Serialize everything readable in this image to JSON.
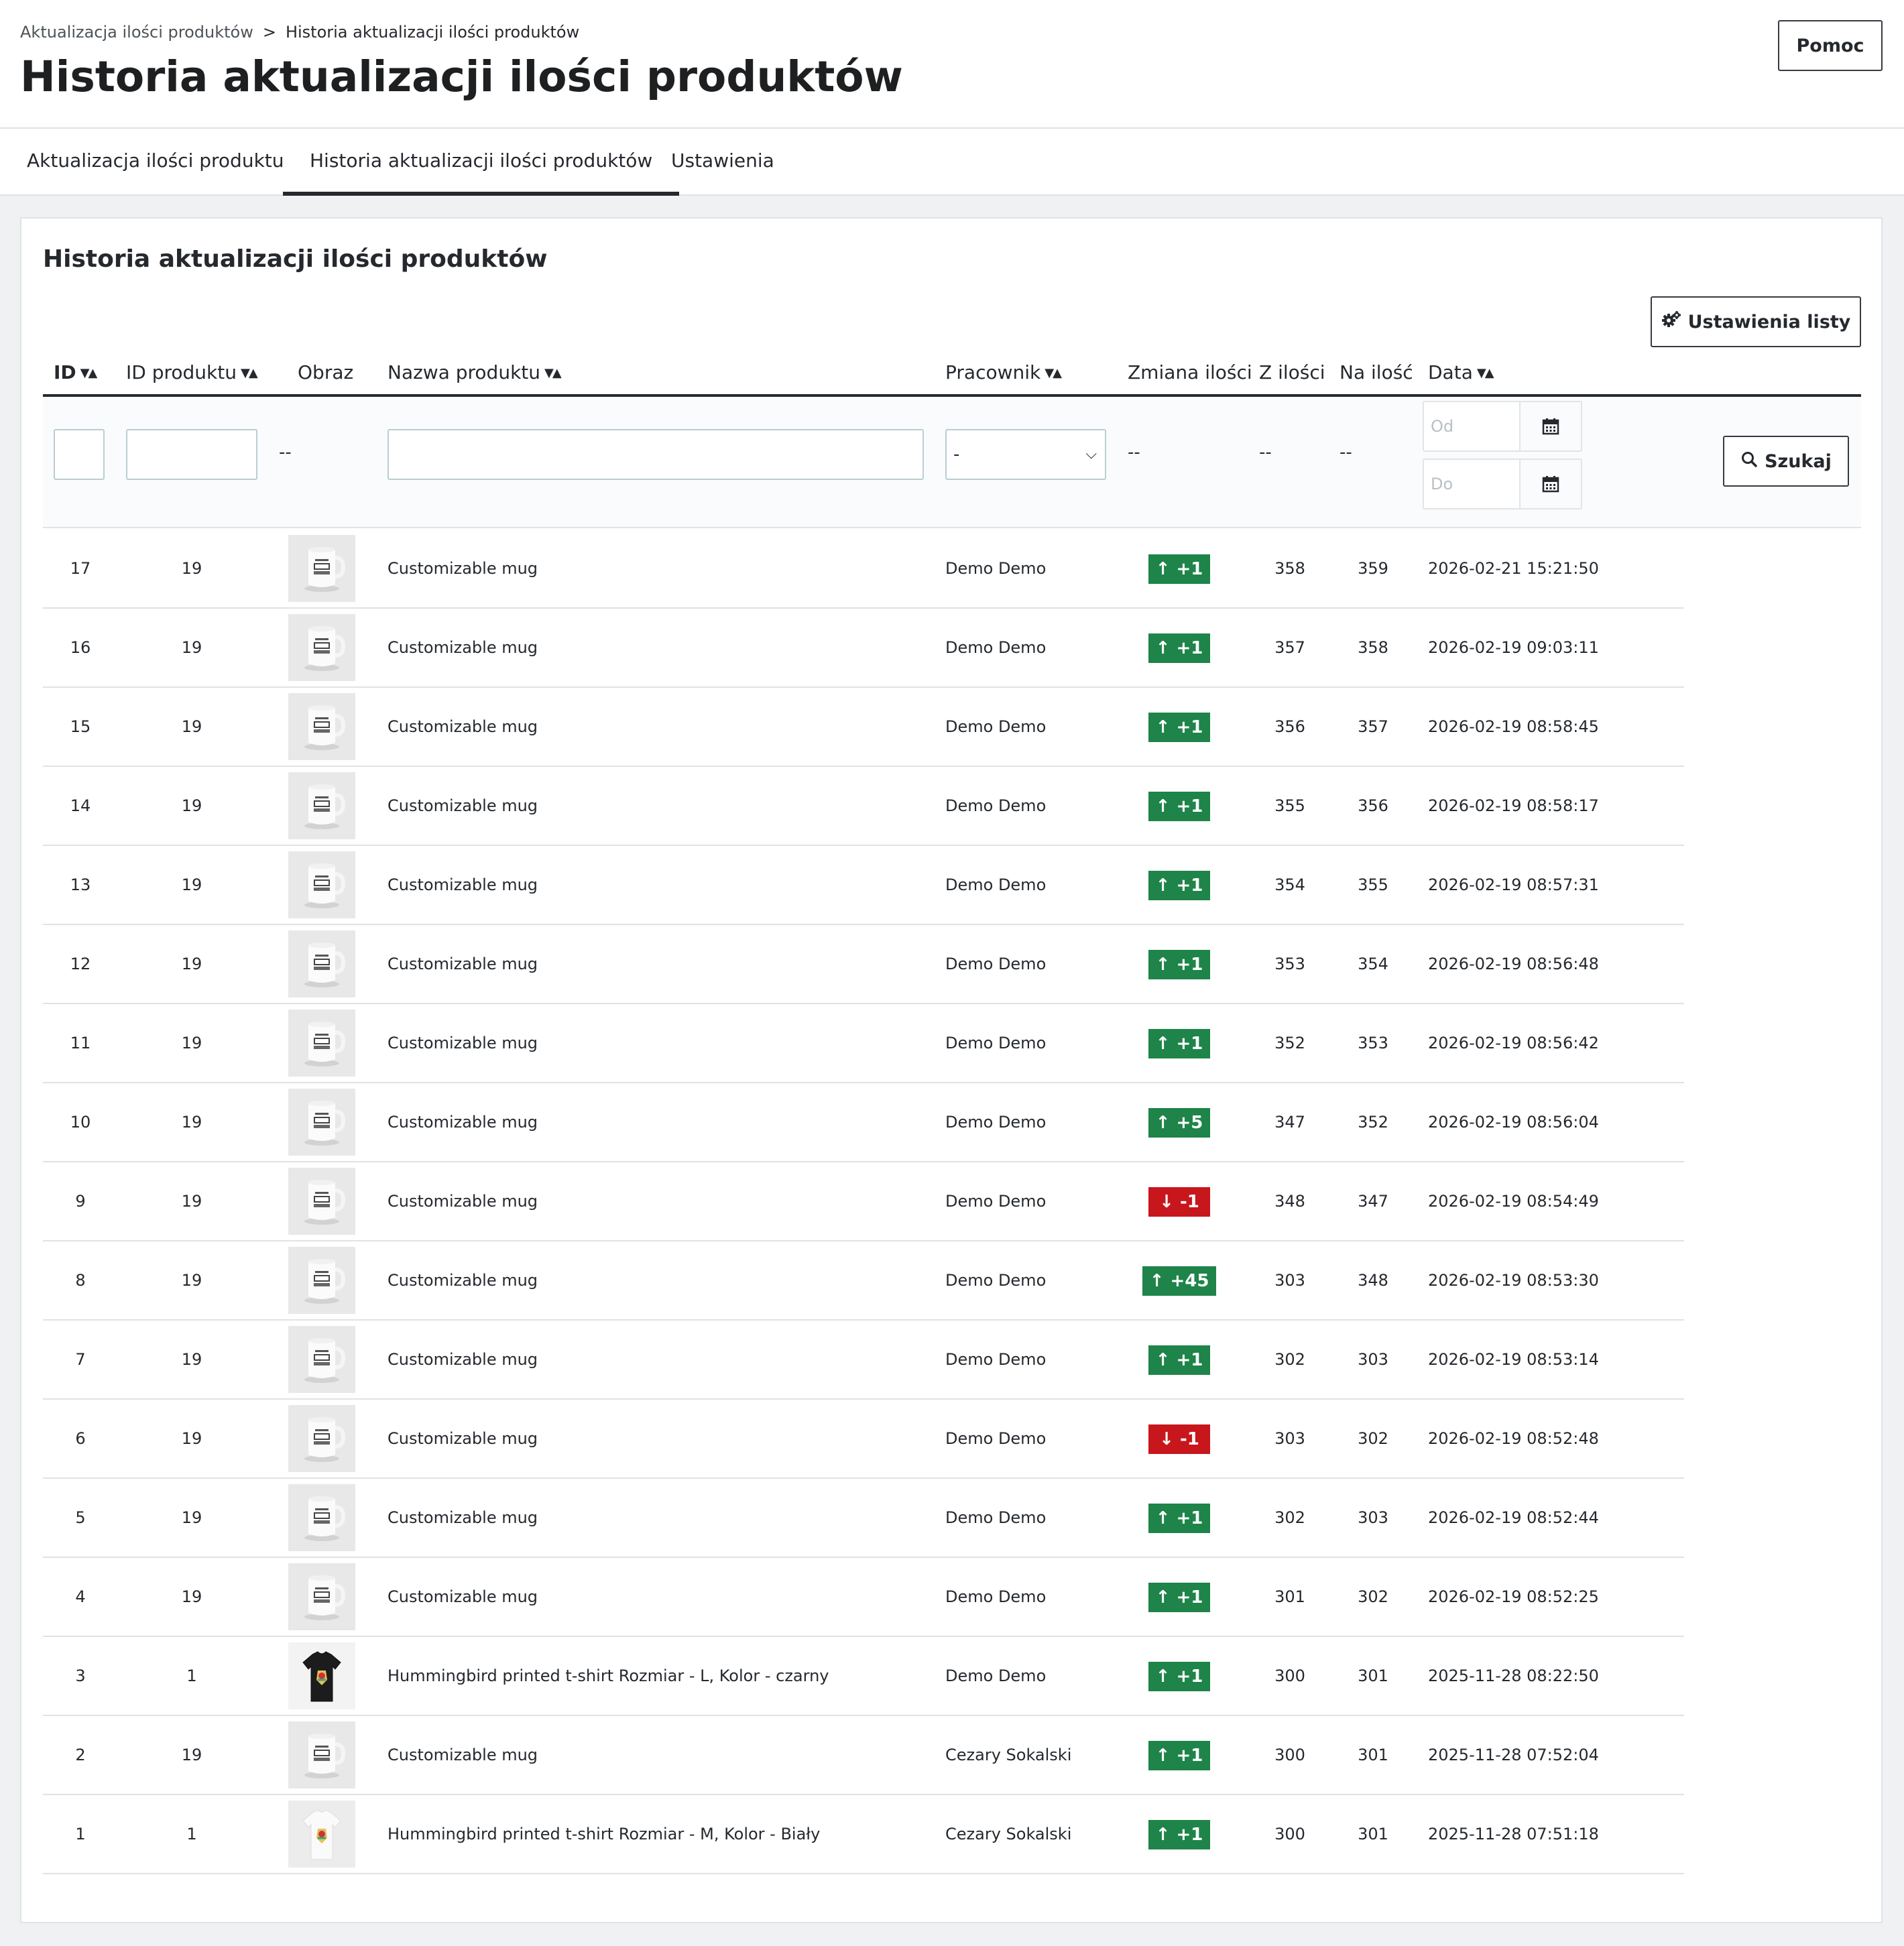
{
  "breadcrumb": {
    "parent": "Aktualizacja ilości produktów",
    "separator": ">",
    "current": "Historia aktualizacji ilości produktów"
  },
  "page_title": "Historia aktualizacji ilości produktów",
  "help_label": "Pomoc",
  "tabs": [
    {
      "label": "Aktualizacja ilości produktu",
      "active": false
    },
    {
      "label": "Historia aktualizacji ilości produktów",
      "active": true
    },
    {
      "label": "Ustawienia",
      "active": false
    }
  ],
  "card": {
    "title": "Historia aktualizacji ilości produktów",
    "list_settings_label": "Ustawienia listy",
    "search_label": "Szukaj"
  },
  "columns": {
    "id": "ID",
    "product_id": "ID produktu",
    "image": "Obraz",
    "product_name": "Nazwa produktu",
    "employee": "Pracownik",
    "change": "Zmiana ilości",
    "from_qty": "Z ilości",
    "to_qty": "Na ilość",
    "date": "Data"
  },
  "filters": {
    "dash": "--",
    "employee_selected": "-",
    "date_from_placeholder": "Od",
    "date_to_placeholder": "Do"
  },
  "colors": {
    "increase": "#1e8449",
    "decrease": "#c8161d"
  },
  "rows": [
    {
      "id": "17",
      "product_id": "19",
      "image": "mug",
      "name": "Customizable mug",
      "employee": "Demo Demo",
      "direction": "up",
      "change": "+1",
      "from": "358",
      "to": "359",
      "date": "2026-02-21 15:21:50"
    },
    {
      "id": "16",
      "product_id": "19",
      "image": "mug",
      "name": "Customizable mug",
      "employee": "Demo Demo",
      "direction": "up",
      "change": "+1",
      "from": "357",
      "to": "358",
      "date": "2026-02-19 09:03:11"
    },
    {
      "id": "15",
      "product_id": "19",
      "image": "mug",
      "name": "Customizable mug",
      "employee": "Demo Demo",
      "direction": "up",
      "change": "+1",
      "from": "356",
      "to": "357",
      "date": "2026-02-19 08:58:45"
    },
    {
      "id": "14",
      "product_id": "19",
      "image": "mug",
      "name": "Customizable mug",
      "employee": "Demo Demo",
      "direction": "up",
      "change": "+1",
      "from": "355",
      "to": "356",
      "date": "2026-02-19 08:58:17"
    },
    {
      "id": "13",
      "product_id": "19",
      "image": "mug",
      "name": "Customizable mug",
      "employee": "Demo Demo",
      "direction": "up",
      "change": "+1",
      "from": "354",
      "to": "355",
      "date": "2026-02-19 08:57:31"
    },
    {
      "id": "12",
      "product_id": "19",
      "image": "mug",
      "name": "Customizable mug",
      "employee": "Demo Demo",
      "direction": "up",
      "change": "+1",
      "from": "353",
      "to": "354",
      "date": "2026-02-19 08:56:48"
    },
    {
      "id": "11",
      "product_id": "19",
      "image": "mug",
      "name": "Customizable mug",
      "employee": "Demo Demo",
      "direction": "up",
      "change": "+1",
      "from": "352",
      "to": "353",
      "date": "2026-02-19 08:56:42"
    },
    {
      "id": "10",
      "product_id": "19",
      "image": "mug",
      "name": "Customizable mug",
      "employee": "Demo Demo",
      "direction": "up",
      "change": "+5",
      "from": "347",
      "to": "352",
      "date": "2026-02-19 08:56:04"
    },
    {
      "id": "9",
      "product_id": "19",
      "image": "mug",
      "name": "Customizable mug",
      "employee": "Demo Demo",
      "direction": "down",
      "change": "-1",
      "from": "348",
      "to": "347",
      "date": "2026-02-19 08:54:49"
    },
    {
      "id": "8",
      "product_id": "19",
      "image": "mug",
      "name": "Customizable mug",
      "employee": "Demo Demo",
      "direction": "up",
      "change": "+45",
      "from": "303",
      "to": "348",
      "date": "2026-02-19 08:53:30"
    },
    {
      "id": "7",
      "product_id": "19",
      "image": "mug",
      "name": "Customizable mug",
      "employee": "Demo Demo",
      "direction": "up",
      "change": "+1",
      "from": "302",
      "to": "303",
      "date": "2026-02-19 08:53:14"
    },
    {
      "id": "6",
      "product_id": "19",
      "image": "mug",
      "name": "Customizable mug",
      "employee": "Demo Demo",
      "direction": "down",
      "change": "-1",
      "from": "303",
      "to": "302",
      "date": "2026-02-19 08:52:48"
    },
    {
      "id": "5",
      "product_id": "19",
      "image": "mug",
      "name": "Customizable mug",
      "employee": "Demo Demo",
      "direction": "up",
      "change": "+1",
      "from": "302",
      "to": "303",
      "date": "2026-02-19 08:52:44"
    },
    {
      "id": "4",
      "product_id": "19",
      "image": "mug",
      "name": "Customizable mug",
      "employee": "Demo Demo",
      "direction": "up",
      "change": "+1",
      "from": "301",
      "to": "302",
      "date": "2026-02-19 08:52:25"
    },
    {
      "id": "3",
      "product_id": "1",
      "image": "tshirt-black",
      "name": "Hummingbird printed t-shirt Rozmiar - L, Kolor - czarny",
      "employee": "Demo Demo",
      "direction": "up",
      "change": "+1",
      "from": "300",
      "to": "301",
      "date": "2025-11-28 08:22:50"
    },
    {
      "id": "2",
      "product_id": "19",
      "image": "mug",
      "name": "Customizable mug",
      "employee": "Cezary Sokalski",
      "direction": "up",
      "change": "+1",
      "from": "300",
      "to": "301",
      "date": "2025-11-28 07:52:04"
    },
    {
      "id": "1",
      "product_id": "1",
      "image": "tshirt-white",
      "name": "Hummingbird printed t-shirt Rozmiar - M, Kolor - Biały",
      "employee": "Cezary Sokalski",
      "direction": "up",
      "change": "+1",
      "from": "300",
      "to": "301",
      "date": "2025-11-28 07:51:18"
    }
  ]
}
